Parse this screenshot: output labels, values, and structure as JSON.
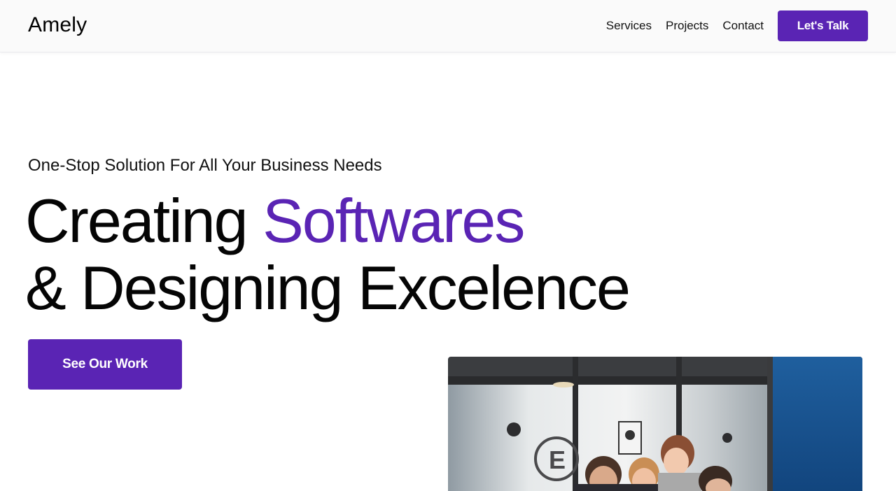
{
  "header": {
    "brand": "Amely",
    "nav": [
      {
        "label": "Services"
      },
      {
        "label": "Projects"
      },
      {
        "label": "Contact"
      }
    ],
    "cta_label": "Let's Talk"
  },
  "hero": {
    "tagline": "One-Stop Solution For All Your Business Needs",
    "headline_word1": "Creating",
    "headline_accent": "Softwares",
    "headline_line2": "& Designing Excelence",
    "cta_label": "See Our Work"
  },
  "colors": {
    "accent": "#5a24b4",
    "header_bg": "#fafafa",
    "text": "#050505"
  }
}
